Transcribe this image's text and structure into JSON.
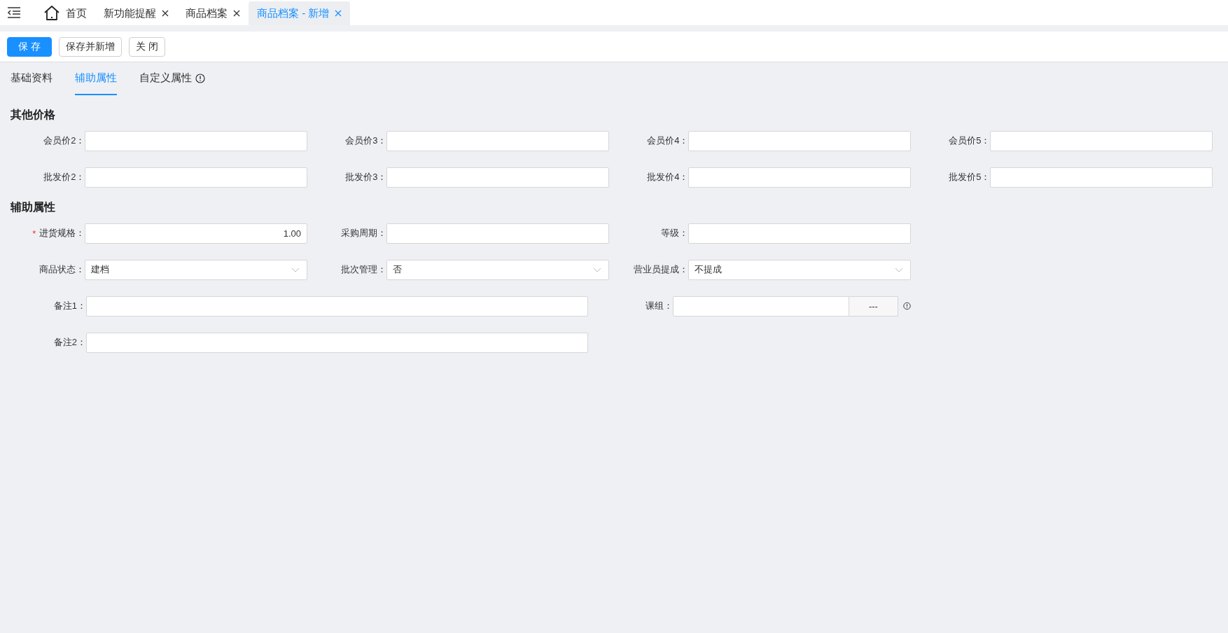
{
  "top_tabs": [
    {
      "label": "首页",
      "kind": "home",
      "selected": false
    },
    {
      "label": "新功能提醒",
      "kind": "page",
      "selected": false
    },
    {
      "label": "商品档案",
      "kind": "page",
      "selected": false
    },
    {
      "label": "商品档案 - 新增",
      "kind": "page",
      "selected": true
    }
  ],
  "toolbar": [
    {
      "label": "保 存",
      "primary": true
    },
    {
      "label": "保存并新增",
      "primary": false
    },
    {
      "label": "关 闭",
      "primary": false
    }
  ],
  "form_tabs": [
    {
      "label": "基础资料",
      "selected": false
    },
    {
      "label": "辅助属性",
      "selected": true
    },
    {
      "label": "自定义属性",
      "selected": false,
      "hint": true
    }
  ],
  "sections": [
    {
      "title": "其他价格",
      "fields": [
        {
          "label": "会员价2：",
          "kind": "text"
        },
        {
          "label": "会员价3：",
          "kind": "text"
        },
        {
          "label": "会员价4：",
          "kind": "text"
        },
        {
          "label": "会员价5：",
          "kind": "text"
        },
        {
          "label": "批发价2：",
          "kind": "text"
        },
        {
          "label": "批发价3：",
          "kind": "text"
        },
        {
          "label": "批发价4：",
          "kind": "text"
        },
        {
          "label": "批发价5：",
          "kind": "text"
        }
      ]
    },
    {
      "title": "辅助属性",
      "fields": [
        {
          "label": "进货规格：",
          "kind": "number",
          "value": "1.00",
          "marker": "*"
        },
        {
          "label": "采购周期：",
          "kind": "text"
        },
        {
          "label": "等级：",
          "kind": "text"
        },
        {
          "kind": "gap"
        },
        {
          "label": "商品状态：",
          "kind": "select",
          "value": "建档"
        },
        {
          "label": "批次管理：",
          "kind": "select",
          "value": "否"
        },
        {
          "label": "营业员提成：",
          "kind": "select",
          "value": "不提成"
        },
        {
          "kind": "gap"
        },
        {
          "label": "备注1：",
          "kind": "text",
          "wide": true
        },
        {
          "label": "课组：",
          "kind": "lookup",
          "button": "---",
          "hint": true
        },
        {
          "kind": "gap"
        },
        {
          "label": "备注2：",
          "kind": "text",
          "wide": true
        }
      ]
    }
  ]
}
